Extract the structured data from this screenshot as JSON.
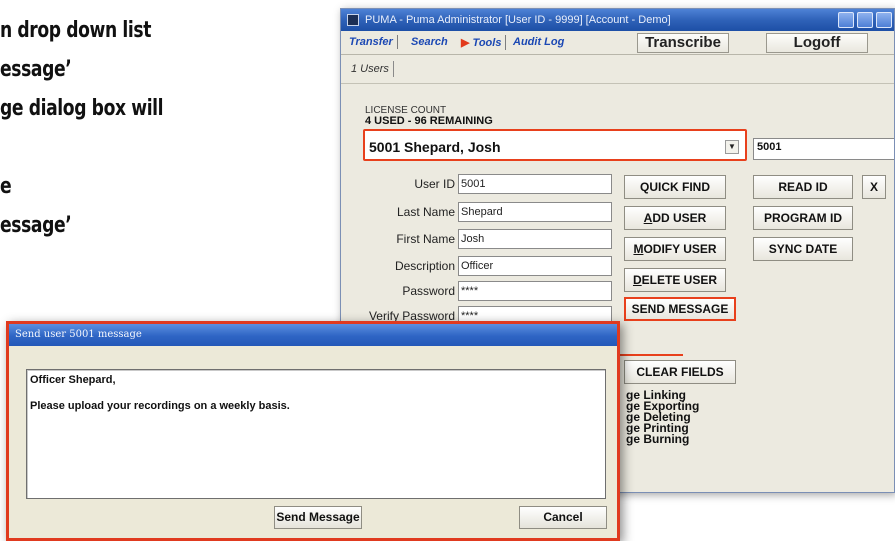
{
  "instructions": {
    "line1": "n drop down list",
    "line2": "essage’",
    "line3": "ge dialog box will",
    "line4": "e",
    "line5": "essage’"
  },
  "main_window": {
    "title": "PUMA - Puma Administrator [User ID - 9999] [Account - Demo]",
    "menu": {
      "transfer": "Transfer",
      "search": "Search",
      "tools": "Tools",
      "audit_log": "Audit Log",
      "transcribe": "Transcribe",
      "logoff": "Logoff"
    },
    "tab": "1 Users",
    "license": {
      "label": "LICENSE COUNT",
      "value": "4 USED - 96 REMAINING"
    },
    "selected_user": "5001  Shepard, Josh",
    "user_id_box": "5001",
    "form": {
      "user_id_label": "User ID",
      "user_id": "5001",
      "last_name_label": "Last Name",
      "last_name": "Shepard",
      "first_name_label": "First Name",
      "first_name": "Josh",
      "description_label": "Description",
      "description": "Officer",
      "password_label": "Password",
      "password": "****",
      "verify_password_label": "Verify Password",
      "verify_password": "****"
    },
    "buttons": {
      "quick_find": "QUICK FIND",
      "add_user": "ADD USER",
      "modify_user": "MODIFY USER",
      "delete_user": "DELETE USER",
      "send_message": "SEND MESSAGE",
      "clear_fields": "CLEAR FIELDS",
      "read_id": "READ ID",
      "close_x": "X",
      "program_id": "PROGRAM ID",
      "sync_date": "SYNC DATE"
    },
    "permissions": [
      "ge Linking",
      "ge Exporting",
      "ge Deleting",
      "ge Printing",
      "ge Burning"
    ]
  },
  "dialog": {
    "title": "Send user 5001 message",
    "message_line1": "Officer Shepard,",
    "message_line2": "Please upload your recordings on a weekly basis.",
    "send_button": "Send Message",
    "cancel_button": "Cancel"
  },
  "colors": {
    "highlight": "#e8401c",
    "titlebar": "#2f62b8",
    "menu_link": "#1b48b4"
  }
}
